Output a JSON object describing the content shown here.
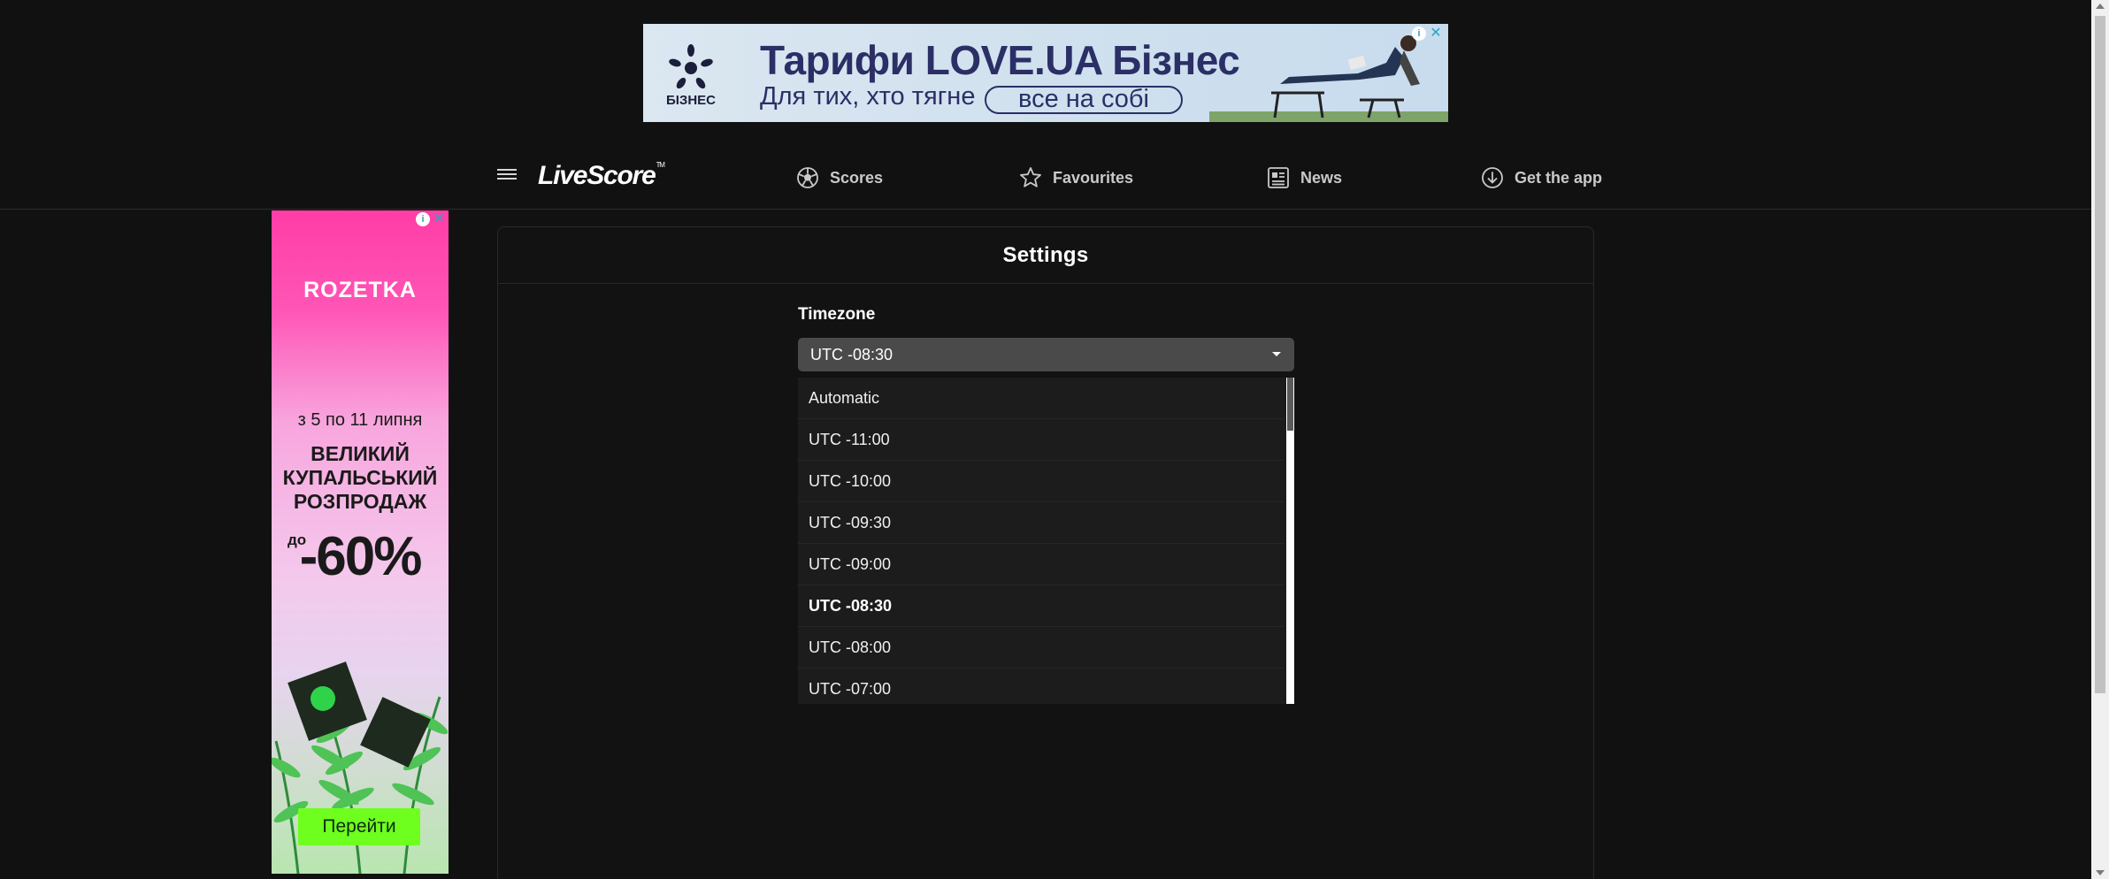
{
  "top_ad": {
    "logo_text": "БІЗНЕС",
    "title": "Тарифи LOVE.UA Бізнес",
    "subtitle": "Для тих, хто тягне",
    "subtitle_highlight": "все на собі",
    "info_badge": "i",
    "close_glyph": "✕",
    "colors": {
      "text": "#2b2f66",
      "background": "#dbe7f1"
    }
  },
  "header": {
    "menu_icon": "hamburger-menu-icon",
    "brand": "LiveScore",
    "brand_tm": "TM",
    "nav": [
      {
        "label": "Scores",
        "icon": "soccer-ball-icon"
      },
      {
        "label": "Favourites",
        "icon": "star-icon"
      },
      {
        "label": "News",
        "icon": "newspaper-icon"
      },
      {
        "label": "Get the app",
        "icon": "download-icon"
      }
    ]
  },
  "side_ad": {
    "brand": "ROZETKA",
    "dates": "з 5 по 11 липня",
    "headline_lines": [
      "ВЕЛИКИЙ",
      "КУПАЛЬСЬКИЙ",
      "РОЗПРОДАЖ"
    ],
    "discount_prefix": "до",
    "discount": "-60%",
    "cta": "Перейти",
    "info_badge": "i",
    "close_glyph": "✕",
    "colors": {
      "brand_pink": "#ff3da6",
      "cta_green": "#6fff1e"
    }
  },
  "settings": {
    "title": "Settings",
    "timezone_label": "Timezone",
    "timezone_value": "UTC -08:30",
    "timezone_options": [
      "Automatic",
      "UTC -11:00",
      "UTC -10:00",
      "UTC -09:30",
      "UTC -09:00",
      "UTC -08:30",
      "UTC -08:00",
      "UTC -07:00"
    ],
    "selected_index": 5
  },
  "colors": {
    "page_background": "#111111",
    "select_background": "#4a4a4a",
    "dropdown_background": "#1c1c1c",
    "nav_text": "#c9c9c9"
  }
}
